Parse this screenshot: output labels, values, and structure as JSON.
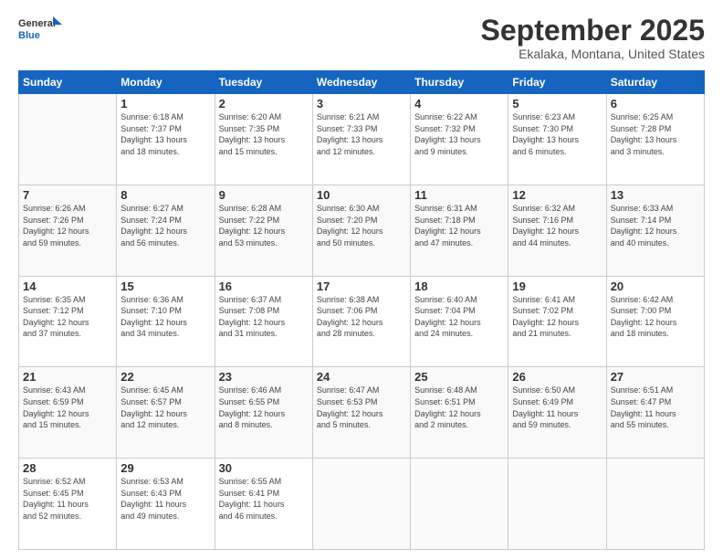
{
  "header": {
    "logo_line1": "General",
    "logo_line2": "Blue",
    "month": "September 2025",
    "location": "Ekalaka, Montana, United States"
  },
  "weekdays": [
    "Sunday",
    "Monday",
    "Tuesday",
    "Wednesday",
    "Thursday",
    "Friday",
    "Saturday"
  ],
  "weeks": [
    [
      {
        "day": "",
        "sunrise": "",
        "sunset": "",
        "daylight": ""
      },
      {
        "day": "1",
        "sunrise": "Sunrise: 6:18 AM",
        "sunset": "Sunset: 7:37 PM",
        "daylight": "Daylight: 13 hours and 18 minutes."
      },
      {
        "day": "2",
        "sunrise": "Sunrise: 6:20 AM",
        "sunset": "Sunset: 7:35 PM",
        "daylight": "Daylight: 13 hours and 15 minutes."
      },
      {
        "day": "3",
        "sunrise": "Sunrise: 6:21 AM",
        "sunset": "Sunset: 7:33 PM",
        "daylight": "Daylight: 13 hours and 12 minutes."
      },
      {
        "day": "4",
        "sunrise": "Sunrise: 6:22 AM",
        "sunset": "Sunset: 7:32 PM",
        "daylight": "Daylight: 13 hours and 9 minutes."
      },
      {
        "day": "5",
        "sunrise": "Sunrise: 6:23 AM",
        "sunset": "Sunset: 7:30 PM",
        "daylight": "Daylight: 13 hours and 6 minutes."
      },
      {
        "day": "6",
        "sunrise": "Sunrise: 6:25 AM",
        "sunset": "Sunset: 7:28 PM",
        "daylight": "Daylight: 13 hours and 3 minutes."
      }
    ],
    [
      {
        "day": "7",
        "sunrise": "Sunrise: 6:26 AM",
        "sunset": "Sunset: 7:26 PM",
        "daylight": "Daylight: 12 hours and 59 minutes."
      },
      {
        "day": "8",
        "sunrise": "Sunrise: 6:27 AM",
        "sunset": "Sunset: 7:24 PM",
        "daylight": "Daylight: 12 hours and 56 minutes."
      },
      {
        "day": "9",
        "sunrise": "Sunrise: 6:28 AM",
        "sunset": "Sunset: 7:22 PM",
        "daylight": "Daylight: 12 hours and 53 minutes."
      },
      {
        "day": "10",
        "sunrise": "Sunrise: 6:30 AM",
        "sunset": "Sunset: 7:20 PM",
        "daylight": "Daylight: 12 hours and 50 minutes."
      },
      {
        "day": "11",
        "sunrise": "Sunrise: 6:31 AM",
        "sunset": "Sunset: 7:18 PM",
        "daylight": "Daylight: 12 hours and 47 minutes."
      },
      {
        "day": "12",
        "sunrise": "Sunrise: 6:32 AM",
        "sunset": "Sunset: 7:16 PM",
        "daylight": "Daylight: 12 hours and 44 minutes."
      },
      {
        "day": "13",
        "sunrise": "Sunrise: 6:33 AM",
        "sunset": "Sunset: 7:14 PM",
        "daylight": "Daylight: 12 hours and 40 minutes."
      }
    ],
    [
      {
        "day": "14",
        "sunrise": "Sunrise: 6:35 AM",
        "sunset": "Sunset: 7:12 PM",
        "daylight": "Daylight: 12 hours and 37 minutes."
      },
      {
        "day": "15",
        "sunrise": "Sunrise: 6:36 AM",
        "sunset": "Sunset: 7:10 PM",
        "daylight": "Daylight: 12 hours and 34 minutes."
      },
      {
        "day": "16",
        "sunrise": "Sunrise: 6:37 AM",
        "sunset": "Sunset: 7:08 PM",
        "daylight": "Daylight: 12 hours and 31 minutes."
      },
      {
        "day": "17",
        "sunrise": "Sunrise: 6:38 AM",
        "sunset": "Sunset: 7:06 PM",
        "daylight": "Daylight: 12 hours and 28 minutes."
      },
      {
        "day": "18",
        "sunrise": "Sunrise: 6:40 AM",
        "sunset": "Sunset: 7:04 PM",
        "daylight": "Daylight: 12 hours and 24 minutes."
      },
      {
        "day": "19",
        "sunrise": "Sunrise: 6:41 AM",
        "sunset": "Sunset: 7:02 PM",
        "daylight": "Daylight: 12 hours and 21 minutes."
      },
      {
        "day": "20",
        "sunrise": "Sunrise: 6:42 AM",
        "sunset": "Sunset: 7:00 PM",
        "daylight": "Daylight: 12 hours and 18 minutes."
      }
    ],
    [
      {
        "day": "21",
        "sunrise": "Sunrise: 6:43 AM",
        "sunset": "Sunset: 6:59 PM",
        "daylight": "Daylight: 12 hours and 15 minutes."
      },
      {
        "day": "22",
        "sunrise": "Sunrise: 6:45 AM",
        "sunset": "Sunset: 6:57 PM",
        "daylight": "Daylight: 12 hours and 12 minutes."
      },
      {
        "day": "23",
        "sunrise": "Sunrise: 6:46 AM",
        "sunset": "Sunset: 6:55 PM",
        "daylight": "Daylight: 12 hours and 8 minutes."
      },
      {
        "day": "24",
        "sunrise": "Sunrise: 6:47 AM",
        "sunset": "Sunset: 6:53 PM",
        "daylight": "Daylight: 12 hours and 5 minutes."
      },
      {
        "day": "25",
        "sunrise": "Sunrise: 6:48 AM",
        "sunset": "Sunset: 6:51 PM",
        "daylight": "Daylight: 12 hours and 2 minutes."
      },
      {
        "day": "26",
        "sunrise": "Sunrise: 6:50 AM",
        "sunset": "Sunset: 6:49 PM",
        "daylight": "Daylight: 11 hours and 59 minutes."
      },
      {
        "day": "27",
        "sunrise": "Sunrise: 6:51 AM",
        "sunset": "Sunset: 6:47 PM",
        "daylight": "Daylight: 11 hours and 55 minutes."
      }
    ],
    [
      {
        "day": "28",
        "sunrise": "Sunrise: 6:52 AM",
        "sunset": "Sunset: 6:45 PM",
        "daylight": "Daylight: 11 hours and 52 minutes."
      },
      {
        "day": "29",
        "sunrise": "Sunrise: 6:53 AM",
        "sunset": "Sunset: 6:43 PM",
        "daylight": "Daylight: 11 hours and 49 minutes."
      },
      {
        "day": "30",
        "sunrise": "Sunrise: 6:55 AM",
        "sunset": "Sunset: 6:41 PM",
        "daylight": "Daylight: 11 hours and 46 minutes."
      },
      {
        "day": "",
        "sunrise": "",
        "sunset": "",
        "daylight": ""
      },
      {
        "day": "",
        "sunrise": "",
        "sunset": "",
        "daylight": ""
      },
      {
        "day": "",
        "sunrise": "",
        "sunset": "",
        "daylight": ""
      },
      {
        "day": "",
        "sunrise": "",
        "sunset": "",
        "daylight": ""
      }
    ]
  ]
}
